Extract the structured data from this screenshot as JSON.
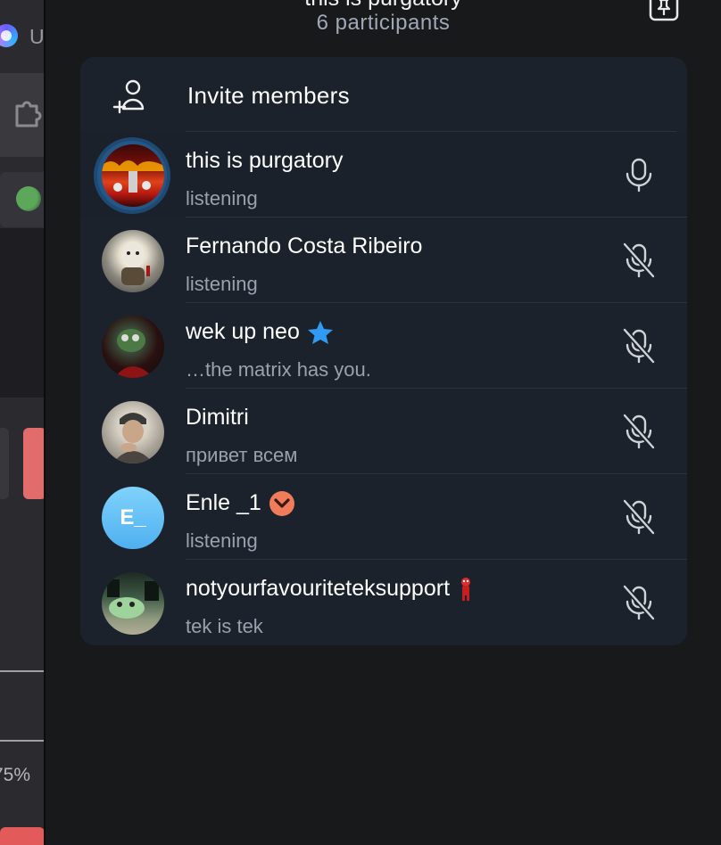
{
  "background_app": {
    "title_fragment": "U",
    "zoom": "75%"
  },
  "voice_chat": {
    "title": "this is purgatory",
    "participants_label": "6 participants",
    "invite_label": "Invite members",
    "participants": [
      {
        "name": "this is purgatory",
        "status": "listening",
        "mic": "on",
        "speaking": true,
        "avatar": "hell-fire-avatar"
      },
      {
        "name": "Fernando Costa Ribeiro",
        "status": "listening",
        "mic": "muted",
        "speaking": false,
        "avatar": "egg-character-avatar"
      },
      {
        "name": "wek up neo",
        "status": "…the matrix has you.",
        "mic": "muted",
        "speaking": false,
        "badge": "star-icon",
        "avatar": "pepe-avatar"
      },
      {
        "name": "Dimitri",
        "status": "привет всем",
        "mic": "muted",
        "speaking": false,
        "avatar": "person-photo-avatar"
      },
      {
        "name": "Enle _1",
        "status": "listening",
        "mic": "muted",
        "speaking": false,
        "badge": "chevron-badge-icon",
        "avatar_initials": "E_"
      },
      {
        "name": "notyourfavouriteteksupport",
        "status": "tek is tek",
        "mic": "muted",
        "speaking": false,
        "badge": "red-figure-icon",
        "avatar": "frog-meme-avatar"
      }
    ]
  },
  "colors": {
    "accent_blue": "#2f9bf5",
    "badge_orange": "#f17c5b",
    "card_bg": "#1b222c"
  }
}
